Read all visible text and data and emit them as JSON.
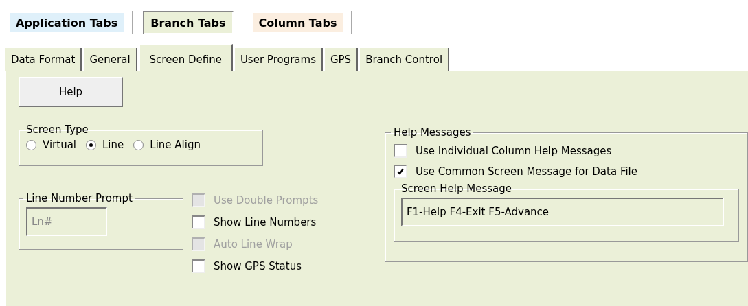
{
  "top_tabs": [
    {
      "label": "Application Tabs",
      "selected": false,
      "color": "#dff0fa"
    },
    {
      "label": "Branch Tabs",
      "selected": true,
      "color": "#ebf0d8"
    },
    {
      "label": "Column Tabs",
      "selected": false,
      "color": "#fbeee0"
    }
  ],
  "sub_tabs": [
    {
      "label": "Data Format",
      "selected": false
    },
    {
      "label": "General",
      "selected": false
    },
    {
      "label": "Screen Define",
      "selected": true
    },
    {
      "label": "User Programs",
      "selected": false
    },
    {
      "label": "GPS",
      "selected": false
    },
    {
      "label": "Branch Control",
      "selected": false
    }
  ],
  "help_button": "Help",
  "screen_type": {
    "title": "Screen Type",
    "options": [
      {
        "label": "Virtual",
        "selected": false
      },
      {
        "label": "Line",
        "selected": true
      },
      {
        "label": "Line Align",
        "selected": false
      }
    ]
  },
  "line_number_prompt": {
    "title": "Line Number Prompt",
    "value": "Ln#",
    "disabled": true
  },
  "options": [
    {
      "label": "Use Double Prompts",
      "checked": false,
      "disabled": true
    },
    {
      "label": "Show Line Numbers",
      "checked": false,
      "disabled": false
    },
    {
      "label": "Auto Line Wrap",
      "checked": false,
      "disabled": true
    },
    {
      "label": "Show GPS Status",
      "checked": false,
      "disabled": false
    }
  ],
  "help_messages": {
    "title": "Help Messages",
    "options": [
      {
        "label": "Use Individual Column Help Messages",
        "checked": false,
        "disabled": false
      },
      {
        "label": "Use Common Screen Message for Data File",
        "checked": true,
        "disabled": false
      }
    ],
    "screen_help_message": {
      "title": "Screen Help Message",
      "value": "F1-Help F4-Exit F5-Advance"
    }
  }
}
